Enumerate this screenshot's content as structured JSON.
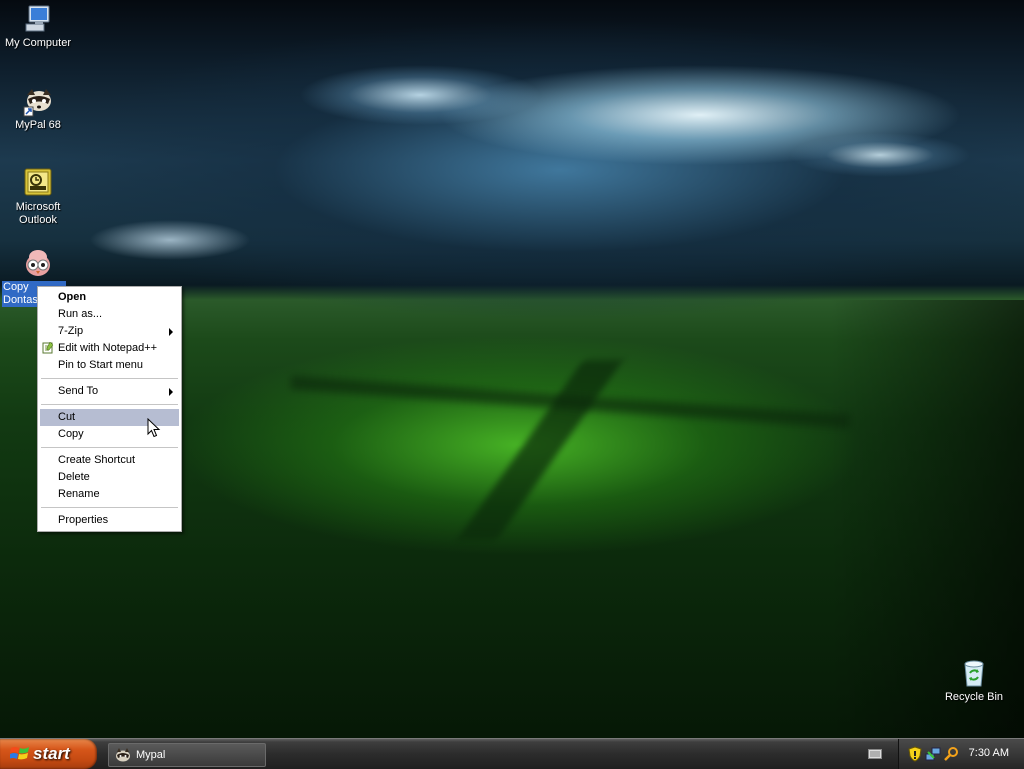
{
  "desktop_icons": {
    "my_computer": "My Computer",
    "mypal": "MyPal 68",
    "outlook_line1": "Microsoft",
    "outlook_line2": "Outlook",
    "copy_dontask": "Copy Dontask",
    "recycle_bin": "Recycle Bin"
  },
  "context_menu": {
    "open": "Open",
    "run_as": "Run as...",
    "seven_zip": "7-Zip",
    "notepadpp": "Edit with Notepad++",
    "pin_start": "Pin to Start menu",
    "send_to": "Send To",
    "cut": "Cut",
    "copy": "Copy",
    "create_shortcut": "Create Shortcut",
    "delete": "Delete",
    "rename": "Rename",
    "properties": "Properties",
    "highlighted": "Cut"
  },
  "taskbar": {
    "start_label": "start",
    "task_mypal": "Mypal",
    "clock": "7:30 AM"
  },
  "colors": {
    "selection": "#316ac5",
    "menu_hover": "#b6bdd2",
    "start_button": "#d6561a"
  }
}
